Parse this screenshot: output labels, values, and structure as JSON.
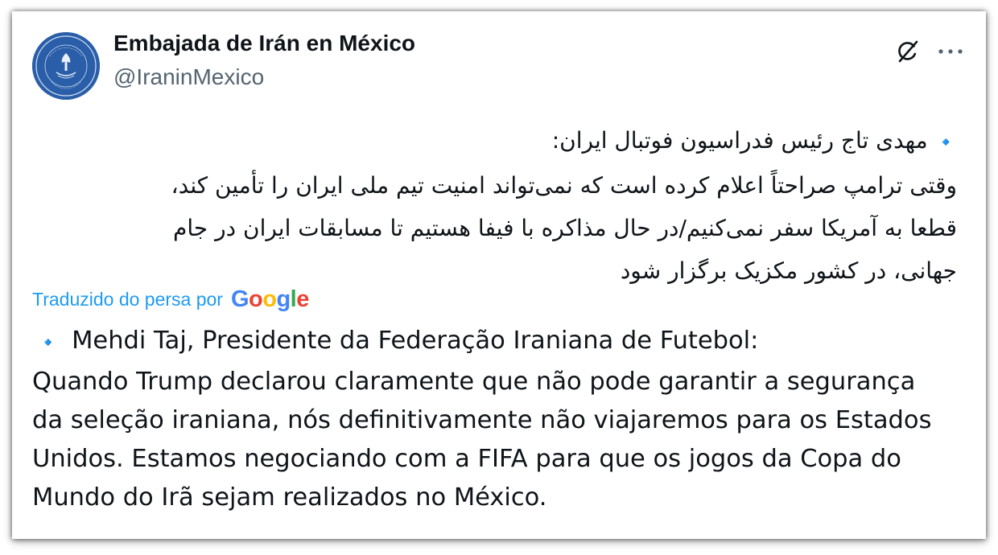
{
  "tweet": {
    "author": {
      "display_name": "Embajada de Irán en México",
      "handle": "@IraninMexico",
      "avatar": {
        "icon": "embassy-seal-avatar",
        "background": "#2b5ea8",
        "seal_top_text": "Embassy of the Islamic Republic of Iran",
        "seal_bottom_text": "Mexico City"
      }
    },
    "actions": {
      "grok_icon": "grok-icon",
      "more_icon": "more-options-icon",
      "more_label": "···"
    },
    "original_text": {
      "direction": "rtl",
      "bullet": "🔹",
      "lines": [
        "مهدی تاج رئیس فدراسیون فوتبال ایران:",
        "وقتی ترامپ صراحتاً اعلام کرده است که نمی‌تواند امنیت تیم ملی ایران را تأمین کند،",
        "قطعا به آمریکا سفر نمی‌کنیم/در حال مذاکره با فیفا هستیم تا مسابقات ایران در جام",
        "جهانی، در کشور مکزیک برگزار شود"
      ]
    },
    "translation": {
      "label": "Traduzido do persa por",
      "provider": "Google",
      "provider_colors": [
        "#4285F4",
        "#EA4335",
        "#FBBC05",
        "#4285F4",
        "#34A853",
        "#EA4335"
      ],
      "bullet": "🔹",
      "lines": [
        "Mehdi Taj, Presidente da Federação Iraniana de Futebol:",
        "Quando Trump declarou claramente que não pode garantir a segurança",
        "da seleção iraniana, nós definitivamente não viajaremos para os Estados",
        "Unidos. Estamos negociando com a FIFA para que os jogos da Copa do",
        "Mundo do Irã sejam realizados no México."
      ]
    },
    "colors": {
      "text_primary": "#0f1419",
      "text_secondary": "#536471",
      "link": "#1d9bf0",
      "bullet": "#4a9ee8"
    }
  }
}
